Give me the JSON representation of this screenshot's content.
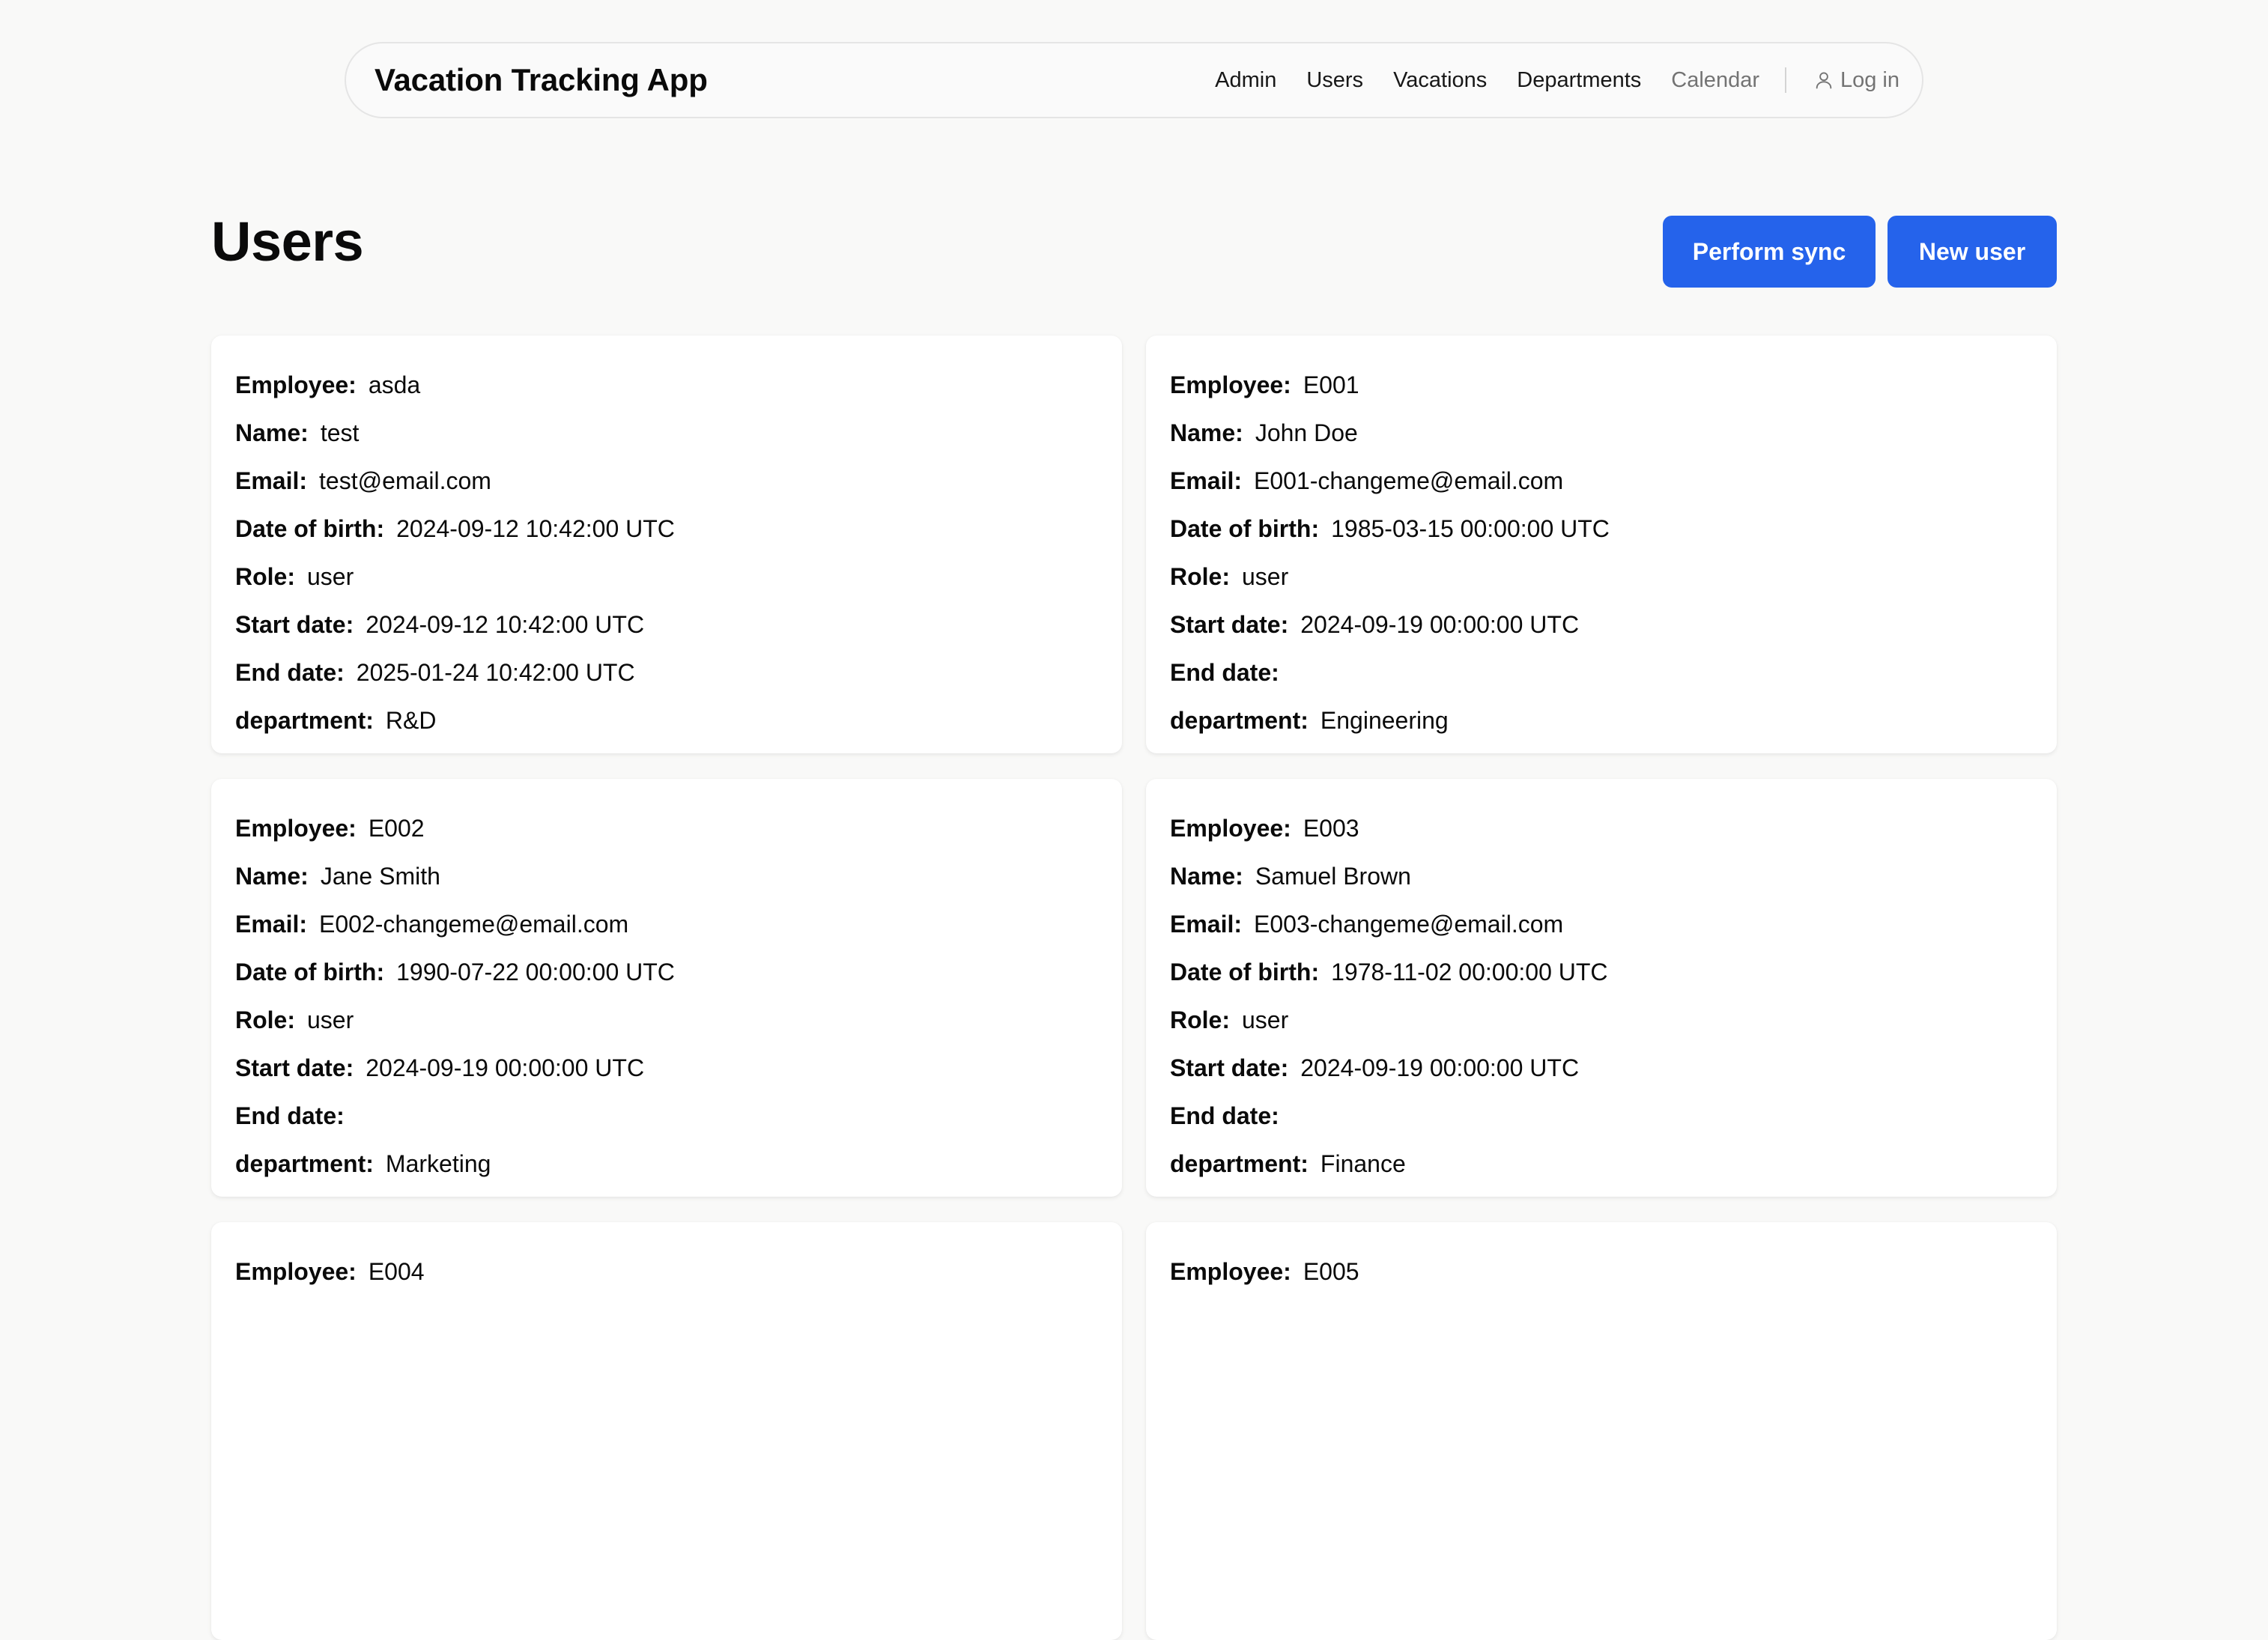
{
  "header": {
    "brand": "Vacation Tracking App",
    "nav": [
      "Admin",
      "Users",
      "Vacations",
      "Departments",
      "Calendar"
    ],
    "login": "Log in"
  },
  "page": {
    "title": "Users",
    "sync_label": "Perform sync",
    "new_label": "New user"
  },
  "labels": {
    "employee": "Employee:",
    "name": "Name:",
    "email": "Email:",
    "dob": "Date of birth:",
    "role": "Role:",
    "start": "Start date:",
    "end": "End date:",
    "department": "department:"
  },
  "users": [
    {
      "employee": "asda",
      "name": "test",
      "email": "test@email.com",
      "dob": "2024-09-12 10:42:00 UTC",
      "role": "user",
      "start": "2024-09-12 10:42:00 UTC",
      "end": "2025-01-24 10:42:00 UTC",
      "department": "R&D"
    },
    {
      "employee": "E001",
      "name": "John Doe",
      "email": "E001-changeme@email.com",
      "dob": "1985-03-15 00:00:00 UTC",
      "role": "user",
      "start": "2024-09-19 00:00:00 UTC",
      "end": "",
      "department": "Engineering"
    },
    {
      "employee": "E002",
      "name": "Jane Smith",
      "email": "E002-changeme@email.com",
      "dob": "1990-07-22 00:00:00 UTC",
      "role": "user",
      "start": "2024-09-19 00:00:00 UTC",
      "end": "",
      "department": "Marketing"
    },
    {
      "employee": "E003",
      "name": "Samuel Brown",
      "email": "E003-changeme@email.com",
      "dob": "1978-11-02 00:00:00 UTC",
      "role": "user",
      "start": "2024-09-19 00:00:00 UTC",
      "end": "",
      "department": "Finance"
    },
    {
      "employee": "E004"
    },
    {
      "employee": "E005"
    }
  ]
}
